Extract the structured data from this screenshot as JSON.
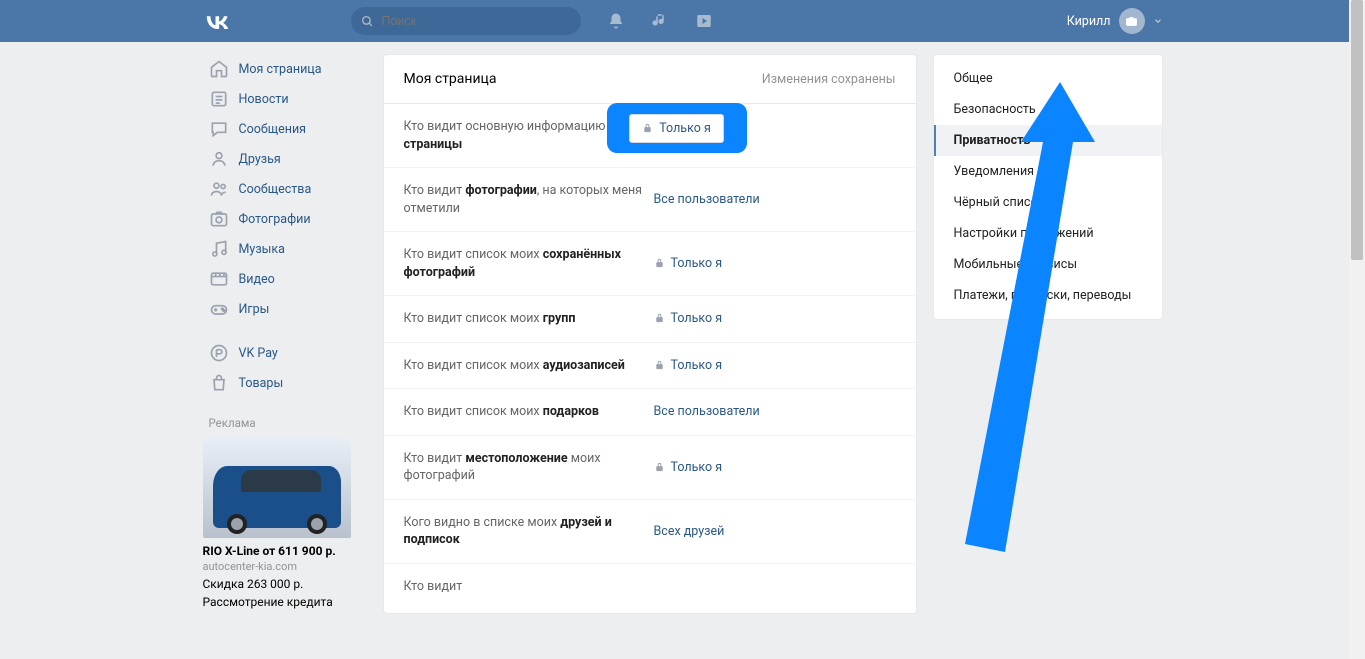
{
  "header": {
    "search_placeholder": "Поиск",
    "username": "Кирилл"
  },
  "leftnav": {
    "items": [
      {
        "id": "my-page",
        "label": "Моя страница"
      },
      {
        "id": "news",
        "label": "Новости"
      },
      {
        "id": "messages",
        "label": "Сообщения"
      },
      {
        "id": "friends",
        "label": "Друзья"
      },
      {
        "id": "communities",
        "label": "Сообщества"
      },
      {
        "id": "photos",
        "label": "Фотографии"
      },
      {
        "id": "music",
        "label": "Музыка"
      },
      {
        "id": "video",
        "label": "Видео"
      },
      {
        "id": "games",
        "label": "Игры"
      }
    ],
    "extra": [
      {
        "id": "vkpay",
        "label": "VK Pay"
      },
      {
        "id": "goods",
        "label": "Товары"
      }
    ],
    "ad_label": "Реклама",
    "ad": {
      "title": "RIO X-Line от 611 900 р.",
      "domain": "autocenter-kia.com",
      "line1": "Скидка 263 000 р.",
      "line2": "Рассмотрение кредита"
    }
  },
  "main": {
    "title": "Моя страница",
    "saved_msg": "Изменения сохранены",
    "highlight_value": "Только я",
    "rows": [
      {
        "pre": "Кто видит основную информацию ",
        "bold": "моей страницы",
        "value": "Только я",
        "lock": true
      },
      {
        "pre": "Кто видит ",
        "bold": "фотографии",
        "post": ", на которых меня отметили",
        "value": "Все пользователи",
        "lock": false
      },
      {
        "pre": "Кто видит список моих ",
        "bold": "сохранённых фотографий",
        "value": "Только я",
        "lock": true
      },
      {
        "pre": "Кто видит список моих ",
        "bold": "групп",
        "value": "Только я",
        "lock": true
      },
      {
        "pre": "Кто видит список моих ",
        "bold": "аудиозаписей",
        "value": "Только я",
        "lock": true
      },
      {
        "pre": "Кто видит список моих ",
        "bold": "подарков",
        "value": "Все пользователи",
        "lock": false
      },
      {
        "pre": "Кто видит ",
        "bold": "местоположение",
        "post": " моих фотографий",
        "value": "Только я",
        "lock": true
      },
      {
        "pre": "Кого видно в списке моих ",
        "bold": "друзей и подписок",
        "value": "Всех друзей",
        "lock": false
      },
      {
        "pre": "Кто видит",
        "bold": "",
        "value": "",
        "lock": false
      }
    ]
  },
  "rightnav": {
    "items": [
      {
        "id": "general",
        "label": "Общее"
      },
      {
        "id": "security",
        "label": "Безопасность"
      },
      {
        "id": "privacy",
        "label": "Приватность",
        "active": true
      },
      {
        "id": "notifications",
        "label": "Уведомления"
      },
      {
        "id": "blacklist",
        "label": "Чёрный список"
      },
      {
        "id": "app-settings",
        "label": "Настройки приложений"
      },
      {
        "id": "mobile",
        "label": "Мобильные сервисы"
      },
      {
        "id": "payments",
        "label": "Платежи, подписки, переводы"
      }
    ]
  }
}
